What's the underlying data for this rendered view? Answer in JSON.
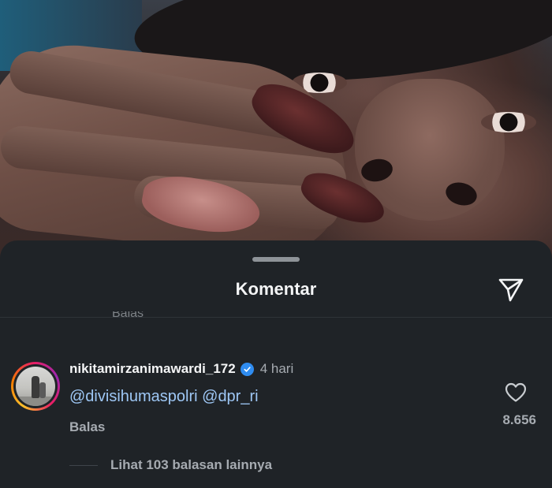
{
  "sheet": {
    "title": "Komentar",
    "share_icon": "send-icon",
    "previous_reply_label": "Balas"
  },
  "comment": {
    "username": "nikitamirzanimawardi_172",
    "verified": true,
    "time_ago": "4 hari",
    "text": "@divisihumaspolri @dpr_ri",
    "reply_label": "Balas",
    "like_icon": "heart-icon",
    "like_count": "8.656",
    "view_replies_label": "Lihat 103 balasan lainnya"
  },
  "colors": {
    "sheet_background": "#1f2327",
    "mention": "#9ec7f5",
    "verified_badge": "#2f8cf0",
    "secondary_text": "#a6abb1"
  }
}
